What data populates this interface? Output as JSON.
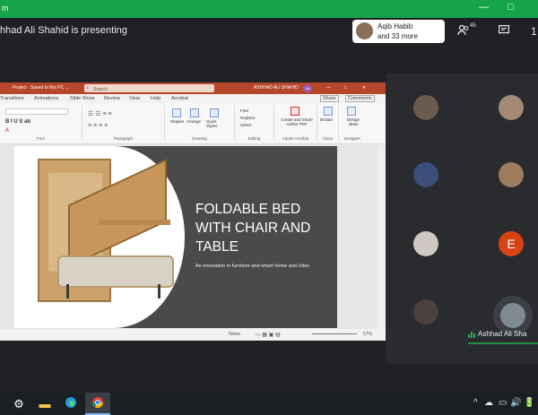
{
  "window": {
    "title": "m",
    "controls": [
      "—",
      "□"
    ]
  },
  "meet": {
    "presenting_text": "hhad Ali Shahid is presenting",
    "presenter_chip": {
      "name": "Aqib Habib",
      "more": "and 33 more"
    },
    "participant_count": "45",
    "icons": [
      "people-icon",
      "chat-icon",
      "activities-icon"
    ],
    "top_right_overflow": "1"
  },
  "powerpoint": {
    "title_bar": {
      "left": "Project · Saved to this PC ⌄",
      "search": "Search",
      "user": "ASHHAD ALI SHAHID",
      "user_initials": "AA",
      "controls": [
        "—",
        "□",
        "✕"
      ]
    },
    "tabs": [
      "Transitions",
      "Animations",
      "Slide Show",
      "Review",
      "View",
      "Help",
      "Acrobat"
    ],
    "share_label": "Share",
    "comments_label": "Comments",
    "ribbon": {
      "group_labels": [
        "Font",
        "Paragraph",
        "Drawing",
        "Editing",
        "Adobe Acrobat",
        "Voice",
        "Designer"
      ],
      "buttons": [
        "Shapes",
        "Arrange",
        "Quick Styles",
        "Find",
        "Replace",
        "Select",
        "Create and Share Adobe PDF",
        "Dictate",
        "Design Ideas"
      ]
    },
    "slide": {
      "title": "FOLDABLE BED WITH CHAIR AND TABLE",
      "subtitle": "An innovation in furniture and smart home and cities"
    },
    "status": {
      "notes": "Notes",
      "zoom": "57%"
    }
  },
  "tiles": {
    "participants": [
      {
        "kind": "photo",
        "color": "#6b5a4e"
      },
      {
        "kind": "photo",
        "color": "#a48a74"
      },
      {
        "kind": "photo",
        "color": "#3b4f7a"
      },
      {
        "kind": "photo",
        "color": "#9e7b5c"
      },
      {
        "kind": "photo",
        "color": "#cfc8bf"
      },
      {
        "kind": "initial",
        "initial": "E",
        "color": "#d84315"
      },
      {
        "kind": "photo",
        "color": "#4a4040"
      }
    ],
    "speaker_name": "Ashhad Ali Sha"
  },
  "taskbar": {
    "apps": [
      "settings-icon",
      "file-explorer-icon",
      "edge-icon",
      "chrome-icon"
    ],
    "tray": [
      "^",
      "☁",
      "▭",
      "🔊",
      "🔋"
    ]
  }
}
